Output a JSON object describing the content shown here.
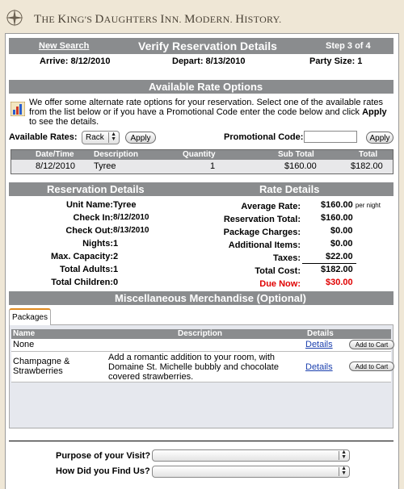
{
  "site": {
    "title_parts": [
      "T",
      "HE ",
      "K",
      "ING'S ",
      "D",
      "AUGHTERS ",
      "I",
      "NN. ",
      "M",
      "ODERN. ",
      "H",
      "ISTORY."
    ]
  },
  "verify": {
    "new_search": "New Search",
    "title": "Verify Reservation Details",
    "step": "Step 3 of 4",
    "arrive": "Arrive: 8/12/2010",
    "depart": "Depart: 8/13/2010",
    "party_size": "Party Size: 1"
  },
  "rates": {
    "title": "Available Rate Options",
    "note_pre": "We offer some alternate rate options for your reservation. Select one of the available rates from the list below or if you have a Promotional Code enter the code below and click ",
    "note_apply": "Apply",
    "note_post": " to see the details.",
    "available_rates_label": "Available Rates:",
    "available_rates_value": "Rack",
    "apply_label": "Apply",
    "promo_label": "Promotional Code:",
    "promo_value": "",
    "promo_apply_label": "Apply",
    "columns": [
      "Date/Time",
      "Description",
      "Quantity",
      "Sub Total",
      "Total"
    ],
    "rows": [
      {
        "date": "8/12/2010",
        "description": "Tyree",
        "quantity": "1",
        "subtotal": "$160.00",
        "total": "$182.00"
      }
    ]
  },
  "reservation": {
    "title": "Reservation Details",
    "fields": [
      {
        "label": "Unit Name:",
        "value": "Tyree"
      },
      {
        "label": "Check In:",
        "value": "8/12/2010"
      },
      {
        "label": "Check Out:",
        "value": "8/13/2010"
      },
      {
        "label": "Nights:",
        "value": "1"
      },
      {
        "label": "Max. Capacity:",
        "value": "2"
      },
      {
        "label": "Total Adults:",
        "value": "1"
      },
      {
        "label": "Total Children:",
        "value": "0"
      }
    ]
  },
  "rate_details": {
    "title": "Rate Details",
    "per_night": "per night",
    "fields": [
      {
        "label": "Average Rate:",
        "value": "$160.00"
      },
      {
        "label": "Reservation Total:",
        "value": "$160.00"
      },
      {
        "label": "Package Charges:",
        "value": "$0.00"
      },
      {
        "label": "Additional Items:",
        "value": "$0.00"
      },
      {
        "label": "Taxes:",
        "value": "$22.00"
      },
      {
        "label": "Total Cost:",
        "value": "$182.00"
      },
      {
        "label": "Due Now:",
        "value": "$30.00"
      }
    ]
  },
  "merch": {
    "title": "Miscellaneous Merchandise (Optional)",
    "tab": "Packages",
    "columns": [
      "Name",
      "Description",
      "Details"
    ],
    "items": [
      {
        "name": "None",
        "description": "",
        "details": "Details",
        "action": "Add to Cart"
      },
      {
        "name_line1": "Champagne &",
        "name_line2": "Strawberries",
        "desc_line1": "Add a romantic addition to your room, with",
        "desc_line2": "Domaine St. Michelle bubbly and chocolate",
        "desc_line3": "covered strawberries.",
        "details": "Details",
        "action": "Add to Cart"
      }
    ]
  },
  "survey": {
    "purpose_label": "Purpose of your Visit?",
    "purpose_value": "",
    "found_label": "How Did you Find Us?",
    "found_value": ""
  },
  "colors": {
    "bar": "#8a8c8e",
    "accent_red": "#e00000",
    "link_blue": "#1a3fae",
    "tab_accent": "#e08a20"
  }
}
